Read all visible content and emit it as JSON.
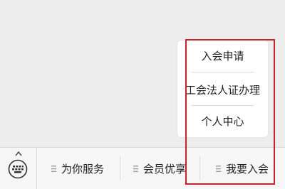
{
  "submenu": {
    "items": [
      {
        "label": "入会申请"
      },
      {
        "label": "工会法人证办理"
      },
      {
        "label": "个人中心"
      }
    ]
  },
  "bottom_bar": {
    "tabs": [
      {
        "label": "为你服务"
      },
      {
        "label": "会员优享"
      },
      {
        "label": "我要入会"
      }
    ]
  },
  "colors": {
    "highlight": "#c8232c",
    "background": "#ededed",
    "bar": "#f6f6f6"
  }
}
